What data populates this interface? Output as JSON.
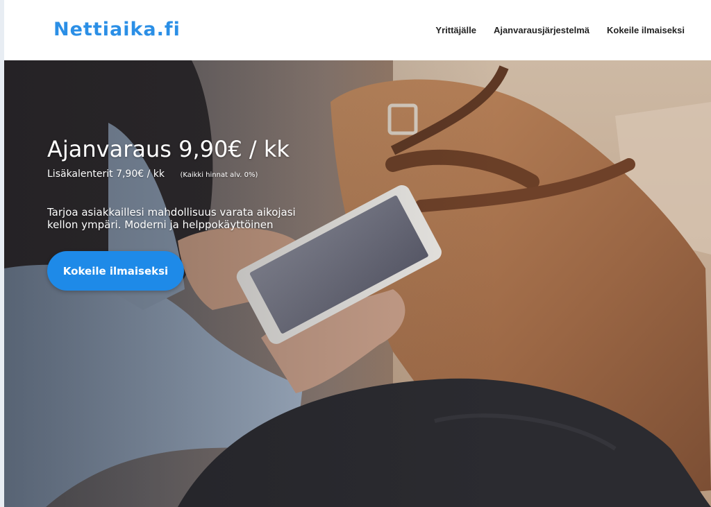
{
  "header": {
    "logo": "Nettiaika.fi",
    "nav": [
      {
        "label": "Yrittäjälle"
      },
      {
        "label": "Ajanvarausjärjestelmä"
      },
      {
        "label": "Kokeile ilmaiseksi"
      }
    ]
  },
  "hero": {
    "title": "Ajanvaraus 9,90€ / kk",
    "extra_price": "Lisäkalenterit 7,90€ / kk",
    "vat_note": "(Kaikki hinnat alv. 0%)",
    "description": "Tarjoa asiakkaillesi mahdollisuus varata aikojasi kellon ympäri. Moderni ja helppokäyttöinen",
    "cta_label": "Kokeile ilmaiseksi",
    "background_image": "woman-holding-smartphone-next-to-leather-bag"
  },
  "colors": {
    "brand": "#2b8fe6",
    "cta": "#1e8ae8",
    "nav_text": "#222222"
  }
}
